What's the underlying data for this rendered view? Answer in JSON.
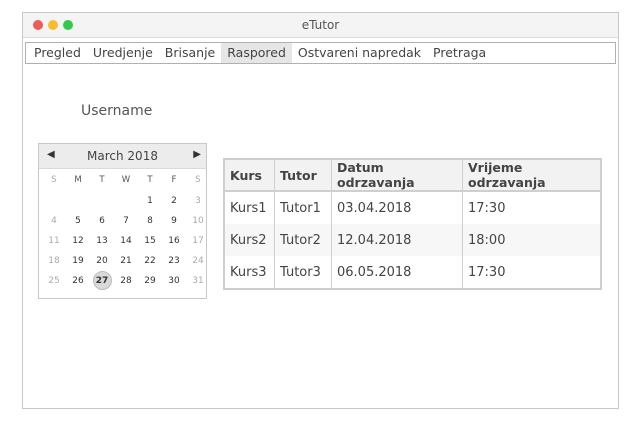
{
  "window": {
    "title": "eTutor",
    "traffic_lights": [
      {
        "name": "close",
        "color": "#ee5c57"
      },
      {
        "name": "minimize",
        "color": "#f6be2f"
      },
      {
        "name": "maximize",
        "color": "#34c84a"
      }
    ]
  },
  "menu": {
    "items": [
      {
        "label": "Pregled"
      },
      {
        "label": "Uredjenje"
      },
      {
        "label": "Brisanje"
      },
      {
        "label": "Raspored",
        "active": true
      },
      {
        "label": "Ostvareni napredak"
      },
      {
        "label": "Pretraga"
      }
    ]
  },
  "user": {
    "username": "Username"
  },
  "calendar": {
    "title": "March 2018",
    "prev_icon": "◀",
    "next_icon": "▶",
    "weekdays": [
      "S",
      "M",
      "T",
      "W",
      "T",
      "F",
      "S"
    ],
    "weeks": [
      [
        "",
        "",
        "",
        "",
        "1",
        "2",
        "3"
      ],
      [
        "4",
        "5",
        "6",
        "7",
        "8",
        "9",
        "10"
      ],
      [
        "11",
        "12",
        "13",
        "14",
        "15",
        "16",
        "17"
      ],
      [
        "18",
        "19",
        "20",
        "21",
        "22",
        "23",
        "24"
      ],
      [
        "25",
        "26",
        "27",
        "28",
        "29",
        "30",
        "31"
      ]
    ],
    "selected_day": "27"
  },
  "schedule": {
    "headers": [
      "Kurs",
      "Tutor",
      "Datum odrzavanja",
      "Vrijeme odrzavanja"
    ],
    "rows": [
      [
        "Kurs1",
        "Tutor1",
        "03.04.2018",
        "17:30"
      ],
      [
        "Kurs2",
        "Tutor2",
        "12.04.2018",
        "18:00"
      ],
      [
        "Kurs3",
        "Tutor3",
        "06.05.2018",
        "17:30"
      ]
    ]
  }
}
